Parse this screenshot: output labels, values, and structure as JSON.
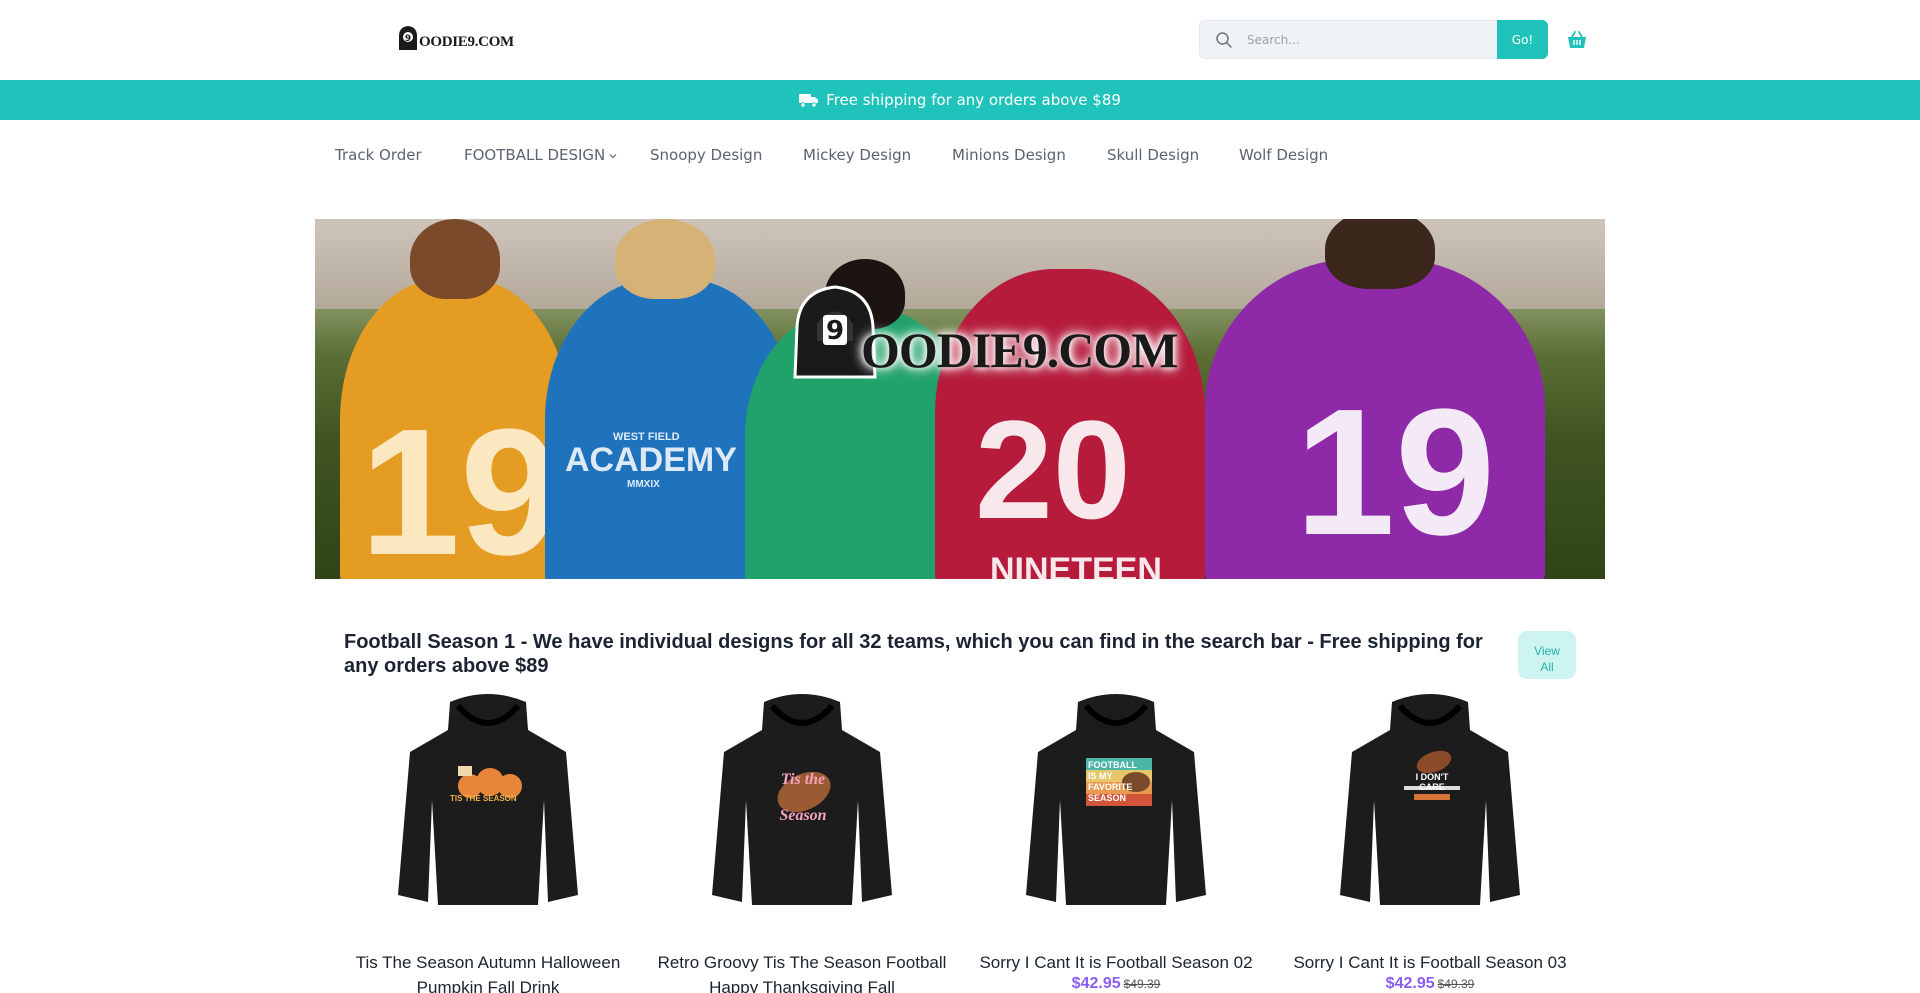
{
  "header": {
    "logo_text": "OODIE9.COM",
    "search": {
      "placeholder": "Search...",
      "value": "",
      "button_label": "Go!"
    }
  },
  "shipping_bar": {
    "text": "Free shipping for any orders above  $89"
  },
  "nav": {
    "items": [
      {
        "label": "Track Order"
      },
      {
        "label": "FOOTBALL DESIGN"
      },
      {
        "label": "Snoopy Design"
      },
      {
        "label": "Mickey Design"
      },
      {
        "label": "Minions Design"
      },
      {
        "label": "Skull Design"
      },
      {
        "label": "Wolf Design"
      }
    ]
  },
  "hero": {
    "logo_text": "OODIE9.COM",
    "hoodie_texts": [
      "19",
      "ACADEMY",
      "20",
      "19",
      "NINETEEN",
      "WEST FIELD",
      "MMXIX"
    ]
  },
  "section": {
    "title": "Football Season 1 - We have individual designs for all 32 teams, which you can find in the search bar - Free shipping for any orders above $89",
    "view_all_line1": "View",
    "view_all_line2": "All"
  },
  "products": [
    {
      "name": "Tis The Season Autumn Halloween Pumpkin Fall Drink",
      "price": "",
      "old_price": "",
      "print_text": "TIS THE SEASON"
    },
    {
      "name": "Retro Groovy Tis The Season Football Happy Thanksgiving Fall",
      "price": "",
      "old_price": "",
      "print_text": "Tis the Season"
    },
    {
      "name": "Sorry I Cant It is Football Season 02",
      "price": "$42.95",
      "old_price": "$49.39",
      "print_text": "FOOTBALL IS MY FAVORITE SEASON"
    },
    {
      "name": "Sorry I Cant It is Football Season 03",
      "price": "$42.95",
      "old_price": "$49.39",
      "print_text": "I DON'T CARE"
    }
  ],
  "colors": {
    "accent": "#20c3bb",
    "sale_price": "#8b5cf6",
    "view_all_bg": "#cdf4f1"
  },
  "icons": [
    "search-icon",
    "basket-icon",
    "truck-icon",
    "chevron-down-icon"
  ]
}
